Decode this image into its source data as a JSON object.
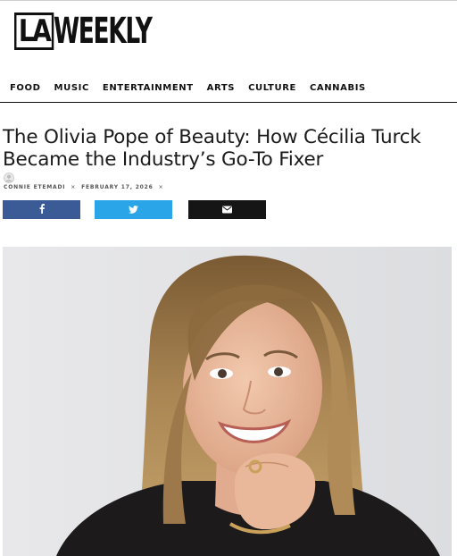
{
  "site": {
    "logo_left": "LA",
    "logo_right": "WEEKLY"
  },
  "nav": {
    "items": [
      {
        "label": "FOOD"
      },
      {
        "label": "MUSIC"
      },
      {
        "label": "ENTERTAINMENT"
      },
      {
        "label": "ARTS"
      },
      {
        "label": "CULTURE"
      },
      {
        "label": "CANNABIS"
      }
    ]
  },
  "article": {
    "title": "The Olivia Pope of Beauty: How Cécilia Turck Became the Industry’s Go-To Fixer",
    "author": "CONNIE ETEMADI",
    "date": "FEBRUARY 17, 2026",
    "separator": "×"
  },
  "share": {
    "facebook_icon": "facebook-icon",
    "twitter_icon": "twitter-icon",
    "email_icon": "envelope-icon"
  },
  "colors": {
    "facebook": "#3b5b96",
    "twitter": "#2aa6e8",
    "email": "#151515",
    "nav_rule": "#111111"
  },
  "hero_image": {
    "subject": "portrait-photo"
  }
}
